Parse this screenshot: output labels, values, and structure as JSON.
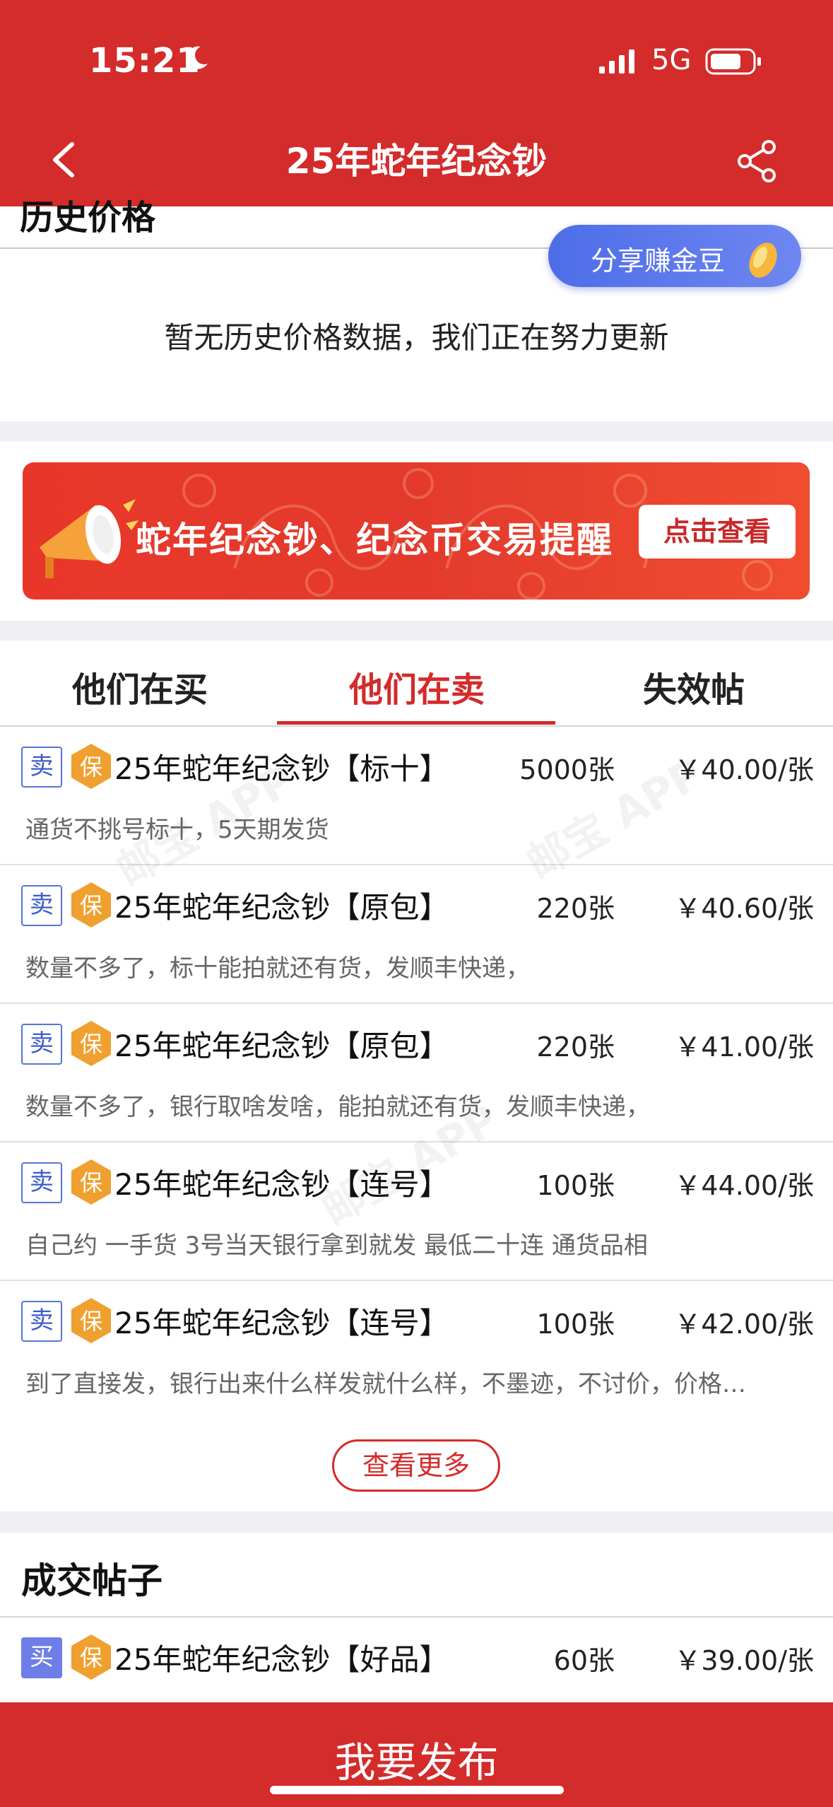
{
  "status_bar": {
    "time": "15:21",
    "network": "5G"
  },
  "nav": {
    "title": "25年蛇年纪念钞"
  },
  "history": {
    "title": "历史价格",
    "empty_message": "暂无历史价格数据，我们正在努力更新",
    "share_bubble": "分享赚金豆"
  },
  "banner": {
    "text": "蛇年纪念钞、纪念币交易提醒",
    "button": "点击查看"
  },
  "tabs": [
    {
      "label": "他们在买"
    },
    {
      "label": "他们在卖",
      "active": true
    },
    {
      "label": "失效帖"
    }
  ],
  "listings": [
    {
      "type": "卖",
      "bao": "保",
      "title": "25年蛇年纪念钞【标十】",
      "qty": "5000张",
      "price": "￥40.00/张",
      "desc": "通货不挑号标十，5天期发货"
    },
    {
      "type": "卖",
      "bao": "保",
      "title": "25年蛇年纪念钞【原包】",
      "qty": "220张",
      "price": "￥40.60/张",
      "desc": "数量不多了，标十能拍就还有货，发顺丰快递，"
    },
    {
      "type": "卖",
      "bao": "保",
      "title": "25年蛇年纪念钞【原包】",
      "qty": "220张",
      "price": "￥41.00/张",
      "desc": "数量不多了，银行取啥发啥，能拍就还有货，发顺丰快递，"
    },
    {
      "type": "卖",
      "bao": "保",
      "title": "25年蛇年纪念钞【连号】",
      "qty": "100张",
      "price": "￥44.00/张",
      "desc": "自己约 一手货 3号当天银行拿到就发 最低二十连 通货品相"
    },
    {
      "type": "卖",
      "bao": "保",
      "title": "25年蛇年纪念钞【连号】",
      "qty": "100张",
      "price": "￥42.00/张",
      "desc": "到了直接发，银行出来什么样发就什么样，不墨迹，不讨价，价格…"
    }
  ],
  "more_button": "查看更多",
  "deals": {
    "title": "成交帖子",
    "items": [
      {
        "type": "买",
        "bao": "保",
        "title": "25年蛇年纪念钞【好品】",
        "qty": "60张",
        "price": "￥39.00/张"
      }
    ]
  },
  "watermark": "邮宝 APP",
  "publish_button": "我要发布",
  "colors": {
    "brand_red": "#d42b2b",
    "share_blue": "#4d6de8",
    "bao_orange": "#f0a030"
  }
}
